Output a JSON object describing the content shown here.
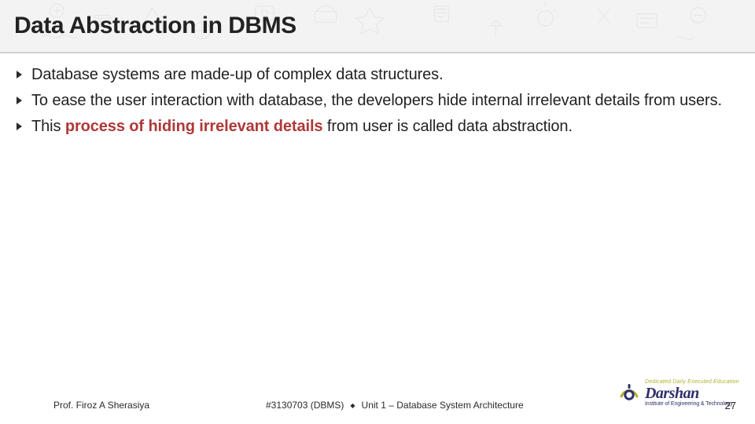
{
  "title": "Data Abstraction in DBMS",
  "bullets": [
    {
      "pre": "Database systems are made-up of complex data structures.",
      "hl": "",
      "post": ""
    },
    {
      "pre": "To ease the user interaction with database, the developers hide internal irrelevant details from users.",
      "hl": "",
      "post": ""
    },
    {
      "pre": "This ",
      "hl": "process of hiding irrelevant details",
      "post": "   from user is called data abstraction."
    }
  ],
  "footer": {
    "author": "Prof. Firoz A Sherasiya",
    "course": "#3130703 (DBMS)",
    "unit": "Unit 1 – Database System Architecture",
    "page": "27"
  },
  "logo": {
    "top": "Dedicated Daily Executed Education",
    "main": "Darshan",
    "sub": "Institute of Engineering & Technology"
  }
}
